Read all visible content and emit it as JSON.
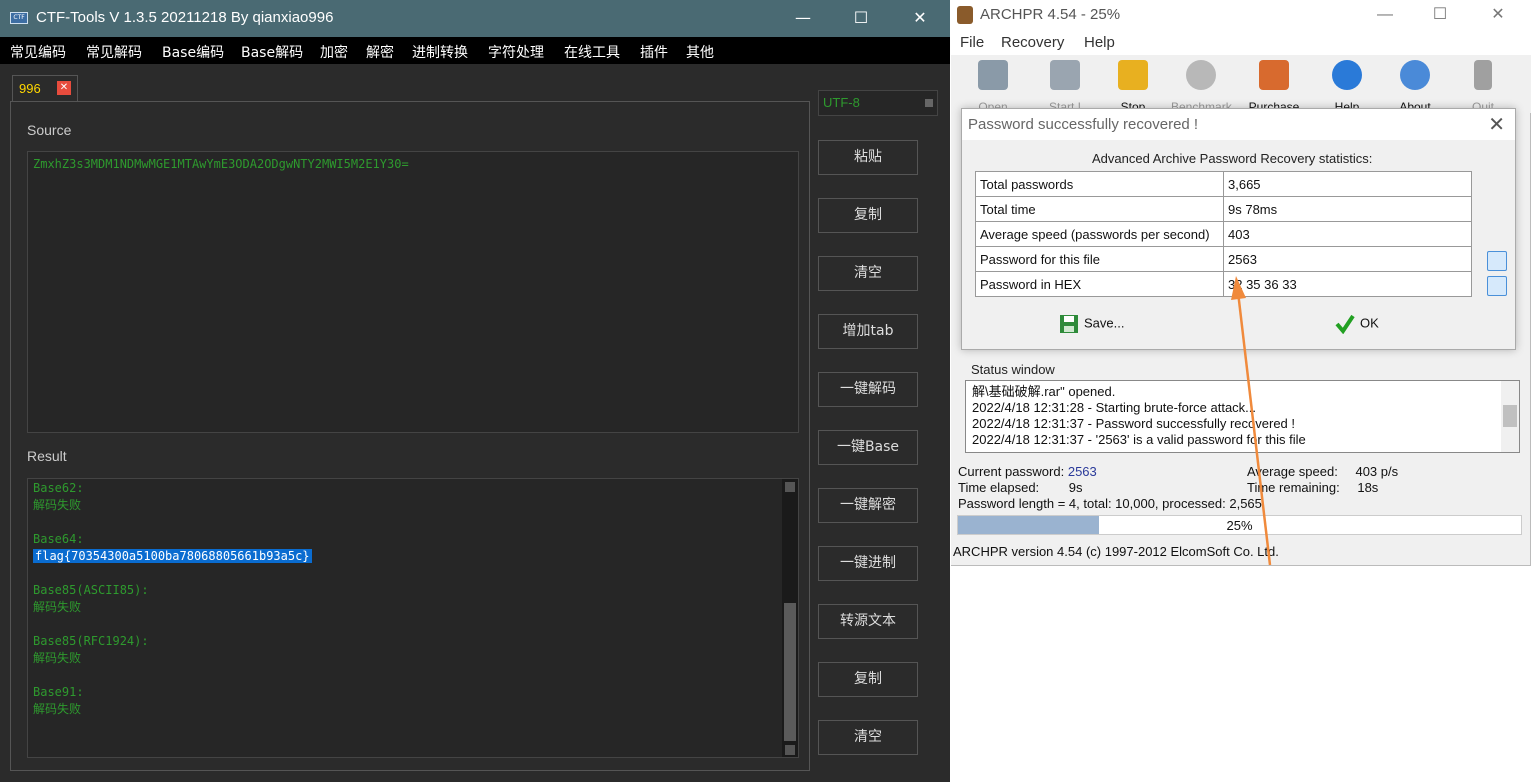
{
  "ctf": {
    "title": "CTF-Tools V 1.3.5 20211218 By qianxiao996",
    "window_buttons": {
      "minimize": "—",
      "maximize": "☐",
      "close": "✕"
    },
    "menu": [
      "常见编码",
      "常见解码",
      "Base编码",
      "Base解码",
      "加密",
      "解密",
      "进制转换",
      "字符处理",
      "在线工具",
      "插件",
      "其他"
    ],
    "tab": {
      "label": "996",
      "close": "✕"
    },
    "source_label": "Source",
    "source_text": "ZmxhZ3s3MDM1NDMwMGE1MTAwYmE3ODA2ODgwNTY2MWI5M2E1Y30=",
    "result_label": "Result",
    "result": {
      "b62_head": "Base62:",
      "b62_val": "解码失败",
      "b64_head": "Base64:",
      "b64_val": "flag{70354300a5100ba78068805661b93a5c}",
      "b85a_head": "Base85(ASCII85):",
      "b85a_val": "解码失败",
      "b85r_head": "Base85(RFC1924):",
      "b85r_val": "解码失败",
      "b91_head": "Base91:",
      "b91_val": "解码失败"
    },
    "encoding": "UTF-8",
    "buttons": [
      "粘贴",
      "复制",
      "清空",
      "增加tab",
      "一键解码",
      "一键Base",
      "一键解密",
      "一键进制",
      "转源文本",
      "复制",
      "清空"
    ]
  },
  "archpr": {
    "title": "ARCHPR 4.54 - 25%",
    "window_buttons": {
      "minimize": "—",
      "maximize": "☐",
      "close": "✕"
    },
    "menu": [
      "File",
      "Recovery",
      "Help"
    ],
    "toolbar": [
      "Open",
      "Start !",
      "Stop",
      "Benchmark",
      "Purchase",
      "Help",
      "About",
      "Quit"
    ],
    "dialog": {
      "title": "Password successfully recovered !",
      "close": "✕",
      "heading": "Advanced Archive Password Recovery statistics:",
      "rows": [
        {
          "key": "Total passwords",
          "value": "3,665"
        },
        {
          "key": "Total time",
          "value": "9s 78ms"
        },
        {
          "key": "Average speed (passwords per second)",
          "value": "403"
        },
        {
          "key": "Password for this file",
          "value": "2563"
        },
        {
          "key": "Password in HEX",
          "value": "32 35 36 33"
        }
      ],
      "save_label": "Save...",
      "ok_label": "OK"
    },
    "status": {
      "label": "Status window",
      "lines": [
        "解\\基础破解.rar\" opened.",
        "2022/4/18 12:31:28 - Starting brute-force attack...",
        "2022/4/18 12:31:37 - Password successfully recovered !",
        "2022/4/18 12:31:37 - '2563' is a valid password for this file"
      ]
    },
    "info": {
      "current_password_label": "Current password:",
      "current_password": "2563",
      "time_elapsed_label": "Time elapsed:",
      "time_elapsed": "9s",
      "password_length": "Password length = 4, total: 10,000, processed: 2,565",
      "average_speed_label": "Average speed:",
      "average_speed": "403 p/s",
      "time_remaining_label": "Time remaining:",
      "time_remaining": "18s"
    },
    "progress": {
      "percent_text": "25%",
      "value": 0.25
    },
    "footer": "ARCHPR version 4.54 (c) 1997-2012 ElcomSoft Co. Ltd."
  },
  "colors": {
    "ctf_titlebar": "#4a6a73",
    "ctf_text_green": "#2e9a2e",
    "selection_blue": "#0a6cd0",
    "annotation_arrow": "#f08a3c"
  }
}
